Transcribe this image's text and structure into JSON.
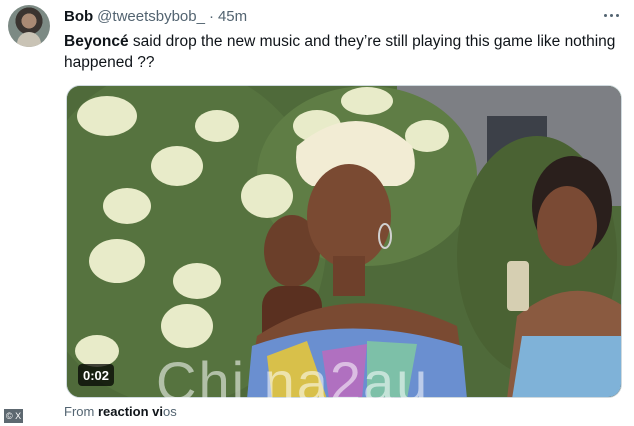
{
  "tweet": {
    "display_name": "Bob",
    "handle": "@tweetsbybob_",
    "separator": "·",
    "time": "45m",
    "text_bold": "Beyoncé",
    "text_rest": " said drop the new music and they’re still playing this game like nothing happened ??",
    "avatar_icon": "user-avatar-photo",
    "more_icon": "more-options-icon"
  },
  "media": {
    "duration": "0:02",
    "watermark": "Chi na2au",
    "description_icon": "video-thumbnail"
  },
  "attribution": {
    "from_label": "From",
    "source": "reaction vi",
    "source_tail": "os"
  },
  "corner_label": "© X",
  "colors": {
    "text_primary": "#0f1419",
    "text_secondary": "#536471",
    "border": "#cfd9de",
    "background": "#ffffff"
  }
}
